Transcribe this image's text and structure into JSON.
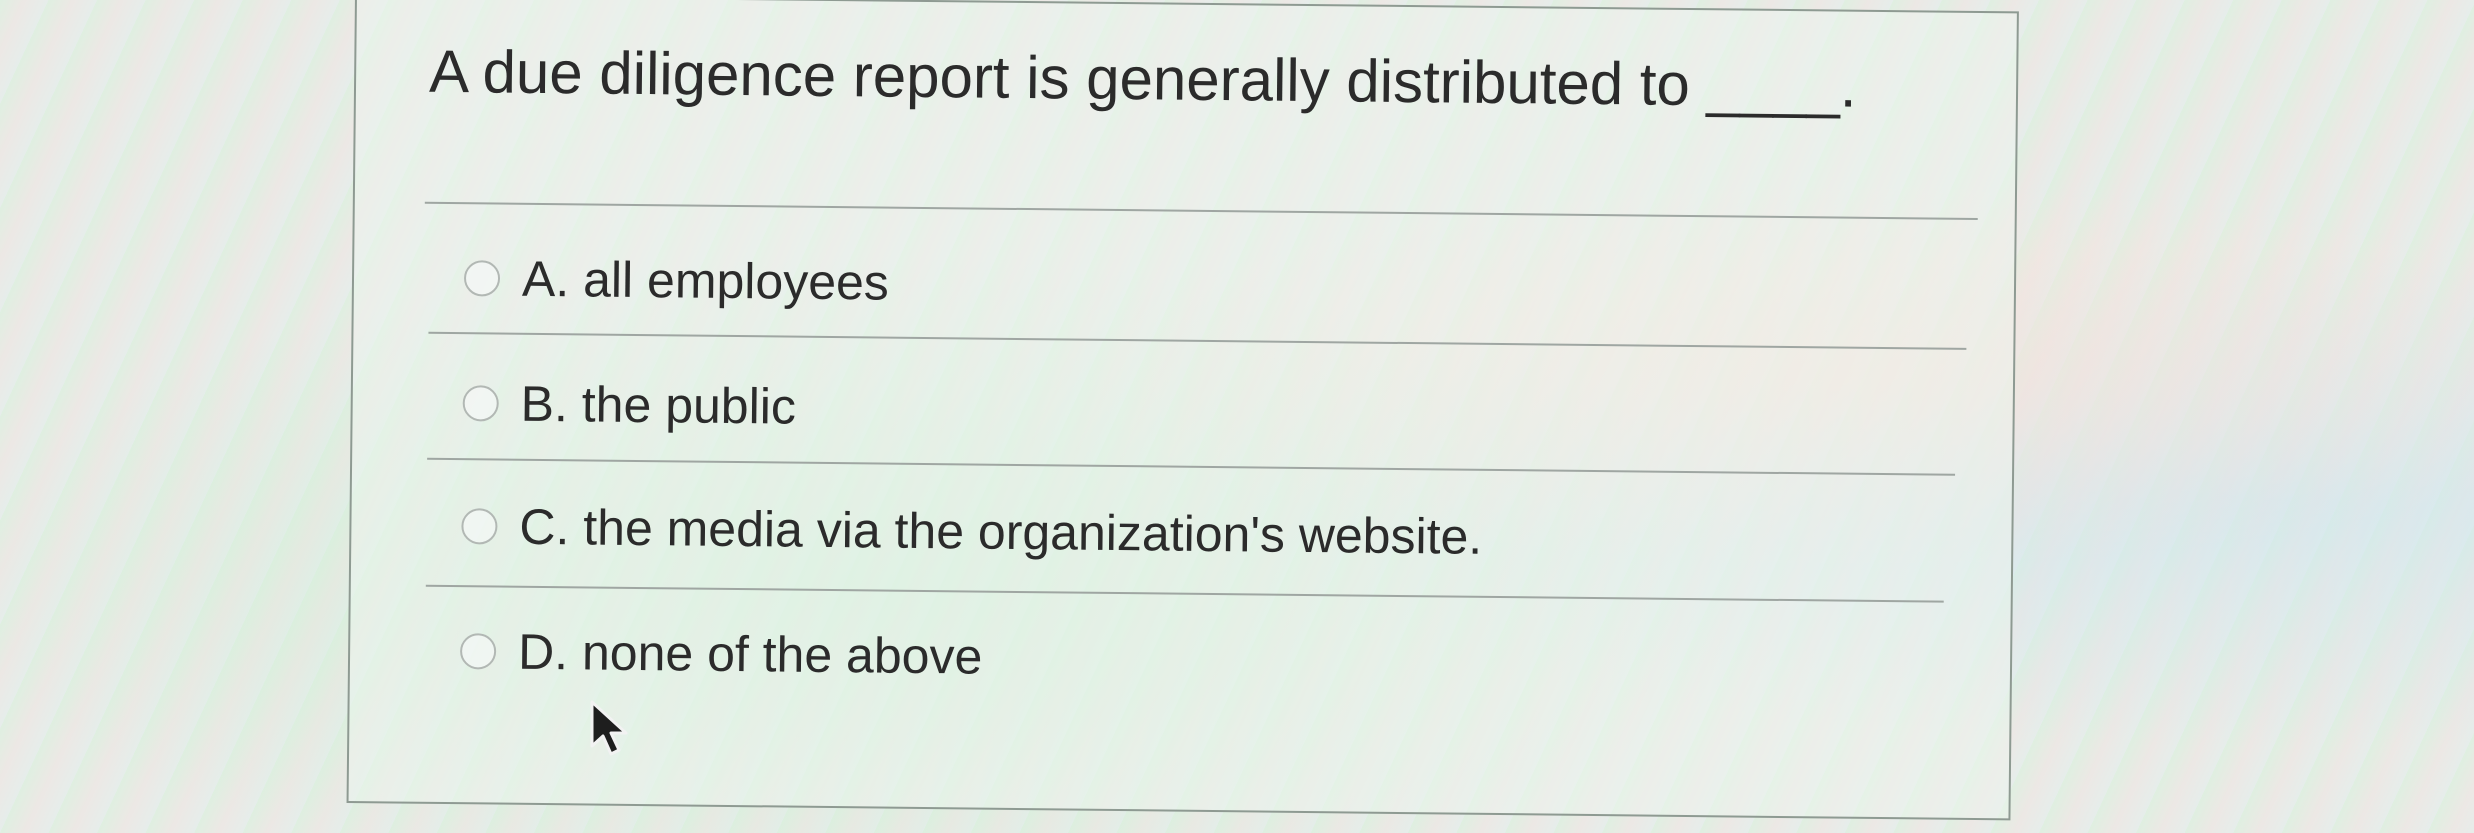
{
  "question": {
    "text": "A due diligence report is generally distributed to ____."
  },
  "options": [
    {
      "label": "A. all employees",
      "selected": false
    },
    {
      "label": "B. the public",
      "selected": false
    },
    {
      "label": "C. the media via the organization's website.",
      "selected": false
    },
    {
      "label": "D. none of the above",
      "selected": false
    }
  ],
  "cursor_icon": "mouse-pointer-arrow-icon"
}
